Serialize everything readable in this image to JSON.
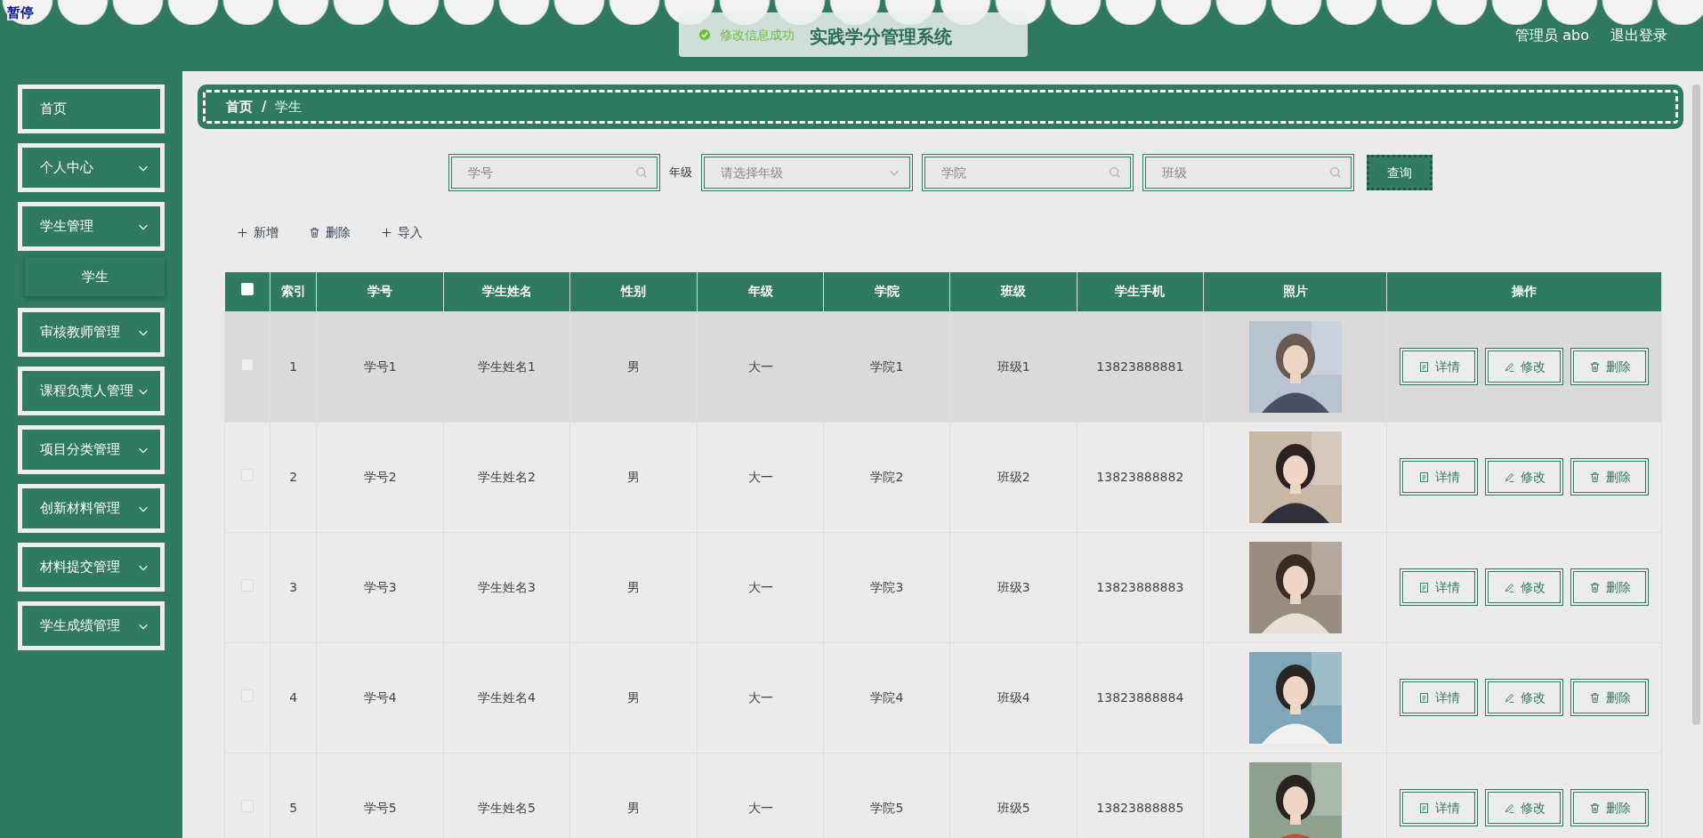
{
  "overlay_label": "暂停",
  "header": {
    "title": "实践学分管理系统",
    "user": "管理员 abo",
    "logout": "退出登录"
  },
  "toast": {
    "message": "修改信息成功"
  },
  "sidebar": {
    "items": [
      {
        "label": "首页",
        "expandable": false
      },
      {
        "label": "个人中心",
        "expandable": true
      },
      {
        "label": "学生管理",
        "expandable": true,
        "children": [
          {
            "label": "学生"
          }
        ]
      },
      {
        "label": "审核教师管理",
        "expandable": true
      },
      {
        "label": "课程负责人管理",
        "expandable": true
      },
      {
        "label": "项目分类管理",
        "expandable": true
      },
      {
        "label": "创新材料管理",
        "expandable": true
      },
      {
        "label": "材料提交管理",
        "expandable": true
      },
      {
        "label": "学生成绩管理",
        "expandable": true
      }
    ]
  },
  "breadcrumb": {
    "items": [
      "首页",
      "学生"
    ],
    "separator": "/"
  },
  "search": {
    "fields": [
      {
        "kind": "text",
        "placeholder": "学号"
      },
      {
        "kind": "label",
        "label": "年级"
      },
      {
        "kind": "select",
        "placeholder": "请选择年级"
      },
      {
        "kind": "text",
        "placeholder": "学院"
      },
      {
        "kind": "text",
        "placeholder": "班级"
      }
    ],
    "button": "查询"
  },
  "toolbar": [
    {
      "kind": "plus",
      "label": "新增"
    },
    {
      "kind": "trash",
      "label": "删除"
    },
    {
      "kind": "plus",
      "label": "导入"
    }
  ],
  "table": {
    "all_checked": false,
    "columns": [
      "索引",
      "学号",
      "学生姓名",
      "性别",
      "年级",
      "学院",
      "班级",
      "学生手机",
      "照片",
      "操作"
    ],
    "rows": [
      {
        "checked": false,
        "highlighted": true,
        "cells": [
          "1",
          "学号1",
          "学生姓名1",
          "男",
          "大一",
          "学院1",
          "班级1",
          "13823888881"
        ],
        "actions": [
          "详情",
          "修改",
          "删除"
        ]
      },
      {
        "checked": false,
        "highlighted": false,
        "cells": [
          "2",
          "学号2",
          "学生姓名2",
          "男",
          "大一",
          "学院2",
          "班级2",
          "13823888882"
        ],
        "actions": [
          "详情",
          "修改",
          "删除"
        ]
      },
      {
        "checked": false,
        "highlighted": false,
        "cells": [
          "3",
          "学号3",
          "学生姓名3",
          "男",
          "大一",
          "学院3",
          "班级3",
          "13823888883"
        ],
        "actions": [
          "详情",
          "修改",
          "删除"
        ]
      },
      {
        "checked": false,
        "highlighted": false,
        "cells": [
          "4",
          "学号4",
          "学生姓名4",
          "男",
          "大一",
          "学院4",
          "班级4",
          "13823888884"
        ],
        "actions": [
          "详情",
          "修改",
          "删除"
        ]
      },
      {
        "checked": false,
        "highlighted": false,
        "cells": [
          "5",
          "学号5",
          "学生姓名5",
          "男",
          "大一",
          "学院5",
          "班级5",
          "13823888885"
        ],
        "actions": [
          "详情",
          "修改",
          "删除"
        ]
      }
    ]
  }
}
